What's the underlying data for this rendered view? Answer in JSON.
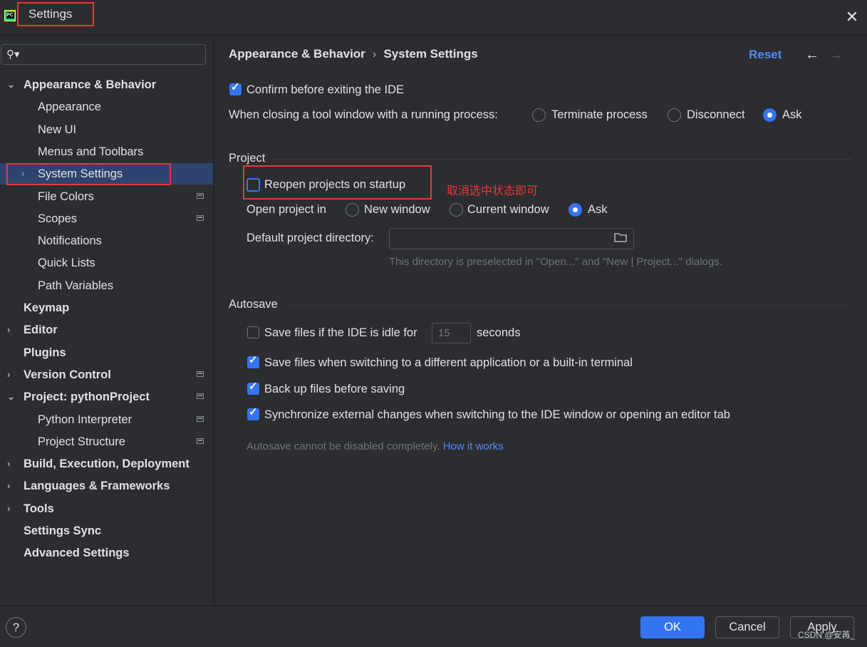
{
  "window": {
    "title": "Settings",
    "logo_text": "PC"
  },
  "sidebar": {
    "search": {
      "value": "",
      "placeholder": ""
    },
    "items": [
      {
        "label": "Appearance & Behavior",
        "level": 0,
        "expanded": true,
        "bold": true
      },
      {
        "label": "Appearance",
        "level": 1
      },
      {
        "label": "New UI",
        "level": 1
      },
      {
        "label": "Menus and Toolbars",
        "level": 1
      },
      {
        "label": "System Settings",
        "level": 1,
        "selected": true,
        "collapsed": true
      },
      {
        "label": "File Colors",
        "level": 1,
        "project_icon": true
      },
      {
        "label": "Scopes",
        "level": 1,
        "project_icon": true
      },
      {
        "label": "Notifications",
        "level": 1
      },
      {
        "label": "Quick Lists",
        "level": 1
      },
      {
        "label": "Path Variables",
        "level": 1
      },
      {
        "label": "Keymap",
        "level": 0,
        "bold": true
      },
      {
        "label": "Editor",
        "level": 0,
        "collapsed": true,
        "bold": true
      },
      {
        "label": "Plugins",
        "level": 0,
        "bold": true
      },
      {
        "label": "Version Control",
        "level": 0,
        "collapsed": true,
        "bold": true,
        "project_icon": true
      },
      {
        "label": "Project: pythonProject",
        "level": 0,
        "expanded": true,
        "bold": true,
        "project_icon": true
      },
      {
        "label": "Python Interpreter",
        "level": 1,
        "project_icon": true
      },
      {
        "label": "Project Structure",
        "level": 1,
        "project_icon": true
      },
      {
        "label": "Build, Execution, Deployment",
        "level": 0,
        "collapsed": true,
        "bold": true
      },
      {
        "label": "Languages & Frameworks",
        "level": 0,
        "collapsed": true,
        "bold": true
      },
      {
        "label": "Tools",
        "level": 0,
        "collapsed": true,
        "bold": true
      },
      {
        "label": "Settings Sync",
        "level": 0,
        "bold": true
      },
      {
        "label": "Advanced Settings",
        "level": 0,
        "bold": true
      }
    ]
  },
  "header": {
    "breadcrumb_parent": "Appearance & Behavior",
    "breadcrumb_separator": "›",
    "breadcrumb_current": "System Settings",
    "reset_label": "Reset",
    "back_icon": "←",
    "forward_icon": "→"
  },
  "general": {
    "confirm_exit": {
      "label": "Confirm before exiting the IDE",
      "checked": true
    },
    "closing_tool_window": {
      "label": "When closing a tool window with a running process:",
      "options": [
        "Terminate process",
        "Disconnect",
        "Ask"
      ],
      "selected": "Ask"
    }
  },
  "project": {
    "section_title": "Project",
    "reopen_on_startup": {
      "label": "Reopen projects on startup",
      "checked": false
    },
    "annotation": "取消选中状态即可",
    "open_project_in": {
      "label": "Open project in",
      "options": [
        "New window",
        "Current window",
        "Ask"
      ],
      "selected": "Ask"
    },
    "default_directory": {
      "label": "Default project directory:",
      "value": "",
      "hint": "This directory is preselected in \"Open...\" and \"New | Project...\" dialogs."
    }
  },
  "autosave": {
    "section_title": "Autosave",
    "idle_save": {
      "label": "Save files if the IDE is idle for",
      "checked": false,
      "value": "15",
      "unit": "seconds"
    },
    "switch_app": {
      "label": "Save files when switching to a different application or a built-in terminal",
      "checked": true
    },
    "backup": {
      "label": "Back up files before saving",
      "checked": true
    },
    "sync_external": {
      "label": "Synchronize external changes when switching to the IDE window or opening an editor tab",
      "checked": true
    },
    "note": "Autosave cannot be disabled completely.",
    "note_link": "How it works"
  },
  "footer": {
    "help_label": "?",
    "ok_label": "OK",
    "cancel_label": "Cancel",
    "apply_label": "Apply",
    "watermark": "CSDN @安苒_"
  },
  "colors": {
    "accent": "#3574f0",
    "link": "#548af7",
    "annotation_red": "#e53935",
    "selection": "#2e436e",
    "background": "#2b2d30"
  }
}
